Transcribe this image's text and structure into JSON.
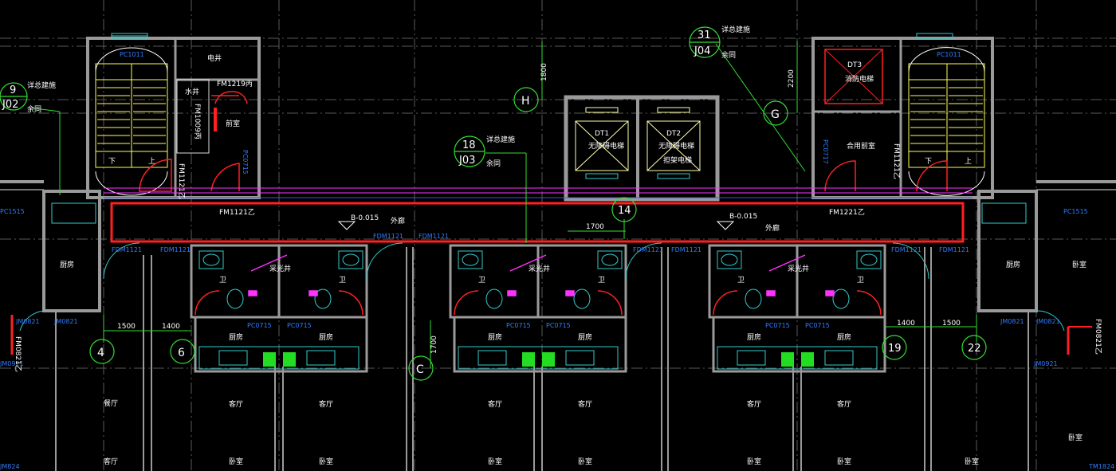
{
  "colors": {
    "background": "#000000",
    "wall": "#8a8a8a",
    "corridor_red": "#ff2020",
    "stair_yellow": "#ffff55",
    "grid_green": "#33dd33",
    "label_blue": "#2f7cff",
    "door_red": "#ff2020",
    "fixture_cyan": "#33cccc",
    "magenta": "#ff33ff"
  },
  "grid_bubbles": {
    "g4": "4",
    "g6": "6",
    "gH": "H",
    "g14": "14",
    "gC": "C",
    "gG": "G",
    "g19": "19",
    "g22": "22"
  },
  "detail_refs": [
    {
      "num": "9",
      "sheet": "J02",
      "note": "详总建施",
      "note2": "余同"
    },
    {
      "num": "18",
      "sheet": "J03",
      "note": "详总建施",
      "note2": "余同"
    },
    {
      "num": "31",
      "sheet": "J04",
      "note": "详总建施",
      "note2": "余同"
    }
  ],
  "dimensions": {
    "d1800": "1800",
    "d2200": "2200",
    "d1700a": "1700",
    "d1700b": "1700",
    "d1500a": "1500",
    "d1400a": "1400",
    "d1400b": "1400",
    "d1500b": "1500"
  },
  "corridor": {
    "elev_left": "B-0.015",
    "elev_right": "B-0.015",
    "label_left": "外廊",
    "label_right": "外廊",
    "door_left": "FM1121乙",
    "door_right": "FM1221乙"
  },
  "core_labels": {
    "pc1011_left": "PC1011",
    "pc1011_right": "PC1011",
    "dianjing": "电井",
    "shuijing": "水井",
    "fm1219": "FM1219丙",
    "fm1009": "FM1009丙",
    "qianshi": "前室",
    "fm1121_stair_left": "FM1121乙",
    "fm1121_stair_right": "FM1121乙",
    "pc0715": "PC0715",
    "pc0717": "PC0717",
    "heyong_qianshi": "合用前室",
    "dt1": "DT1",
    "dt1_sub": "无障碍电梯",
    "dt2": "DT2",
    "dt2_sub": "无障碍电梯",
    "dt2_sub2": "担架电梯",
    "dt3": "DT3",
    "dt3_sub": "消防电梯",
    "xia_left": "下",
    "shang_left": "上",
    "xia_right": "下",
    "shang_right": "上"
  },
  "unit_labels": {
    "pc1515_left": "PC1515",
    "pc1515_right": "PC1515",
    "chufang_left": "厨房",
    "chufang_right": "厨房",
    "wo_right": "卧室",
    "jm0821_a": "JM0821",
    "jm0821_b": "JM0821",
    "jm0821_c": "JM0821",
    "jm0821_d": "JM0821",
    "jm0921_left": "JM0921",
    "jm0921_right": "JM0921",
    "fm0821_left": "FM0821乙",
    "fm0821_right": "FM0821乙",
    "canting": "餐厅",
    "keting_left": "客厅",
    "wo_bottom_right": "卧室",
    "tm1824": "TM1824",
    "jm824": "JM824",
    "fdm1121_1": "FDM1121",
    "fdm1121_2": "FDM1121",
    "fdm1121_3": "FDM1121",
    "fdm1121_4": "FDM1121",
    "fdm1121_5": "FDM1121",
    "fdm1121_6": "FDM1121",
    "fdm1121_7": "FDM1121",
    "fdm1121_8": "FDM1121",
    "caiguangjing": "采光井",
    "wei": "卫",
    "chufang": "厨房",
    "keting": "客厅",
    "woshi": "卧室",
    "pc0715_unit": "PC0715"
  }
}
